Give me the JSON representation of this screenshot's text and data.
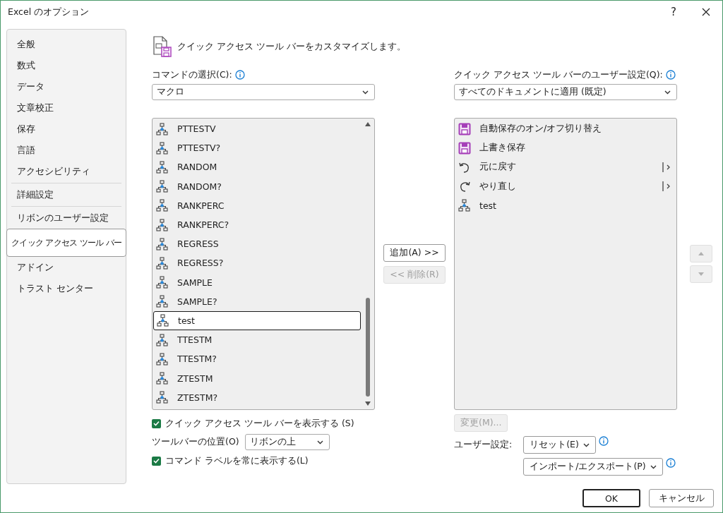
{
  "window": {
    "title": "Excel のオプション",
    "help": "?"
  },
  "sidebar": {
    "groups": [
      [
        {
          "label": "全般",
          "selected": false
        },
        {
          "label": "数式",
          "selected": false
        },
        {
          "label": "データ",
          "selected": false
        },
        {
          "label": "文章校正",
          "selected": false
        },
        {
          "label": "保存",
          "selected": false
        },
        {
          "label": "言語",
          "selected": false
        },
        {
          "label": "アクセシビリティ",
          "selected": false
        }
      ],
      [
        {
          "label": "詳細設定",
          "selected": false
        }
      ],
      [
        {
          "label": "リボンのユーザー設定",
          "selected": false
        },
        {
          "label": "クイック アクセス ツール バー",
          "selected": true
        },
        {
          "label": "アドイン",
          "selected": false
        },
        {
          "label": "トラスト センター",
          "selected": false
        }
      ]
    ]
  },
  "header": "クイック アクセス ツール バーをカスタマイズします。",
  "commands": {
    "label": "コマンドの選択(C):",
    "dropdown": "マクロ",
    "items": [
      {
        "label": "PTTESTV",
        "selected": false
      },
      {
        "label": "PTTESTV?",
        "selected": false
      },
      {
        "label": "RANDOM",
        "selected": false
      },
      {
        "label": "RANDOM?",
        "selected": false
      },
      {
        "label": "RANKPERC",
        "selected": false
      },
      {
        "label": "RANKPERC?",
        "selected": false
      },
      {
        "label": "REGRESS",
        "selected": false
      },
      {
        "label": "REGRESS?",
        "selected": false
      },
      {
        "label": "SAMPLE",
        "selected": false
      },
      {
        "label": "SAMPLE?",
        "selected": false
      },
      {
        "label": "test",
        "selected": true
      },
      {
        "label": "TTESTM",
        "selected": false
      },
      {
        "label": "TTESTM?",
        "selected": false
      },
      {
        "label": "ZTESTM",
        "selected": false
      },
      {
        "label": "ZTESTM?",
        "selected": false
      }
    ]
  },
  "add_button": {
    "label": "追加(A) >>",
    "disabled": false
  },
  "remove_button": {
    "label": "<< 削除(R)",
    "disabled": true
  },
  "toolbar": {
    "label": "クイック アクセス ツール バーのユーザー設定(Q):",
    "dropdown": "すべてのドキュメントに適用 (既定)",
    "items": [
      {
        "label": "自動保存のオン/オフ切り替え",
        "kind": "save",
        "has_submenu": false
      },
      {
        "label": "上書き保存",
        "kind": "save",
        "has_submenu": false
      },
      {
        "label": "元に戻す",
        "kind": "undo",
        "has_submenu": true
      },
      {
        "label": "やり直し",
        "kind": "redo",
        "has_submenu": true
      },
      {
        "label": "test",
        "kind": "macro",
        "has_submenu": false
      }
    ]
  },
  "move_up": {
    "disabled": true
  },
  "move_down": {
    "disabled": true
  },
  "show_toolbar": {
    "label": "クイック アクセス ツール バーを表示する (S)",
    "checked": true
  },
  "position": {
    "label": "ツールバーの位置(O)",
    "dropdown": "リボンの上"
  },
  "show_labels": {
    "label": "コマンド ラベルを常に表示する(L)",
    "checked": true
  },
  "modify_button": {
    "label": "変更(M)...",
    "disabled": true
  },
  "customizations": {
    "label": "ユーザー設定:",
    "reset": "リセット(E)",
    "import_export": "インポート/エクスポート(P)"
  },
  "footer": {
    "ok": "OK",
    "cancel": "キャンセル"
  }
}
